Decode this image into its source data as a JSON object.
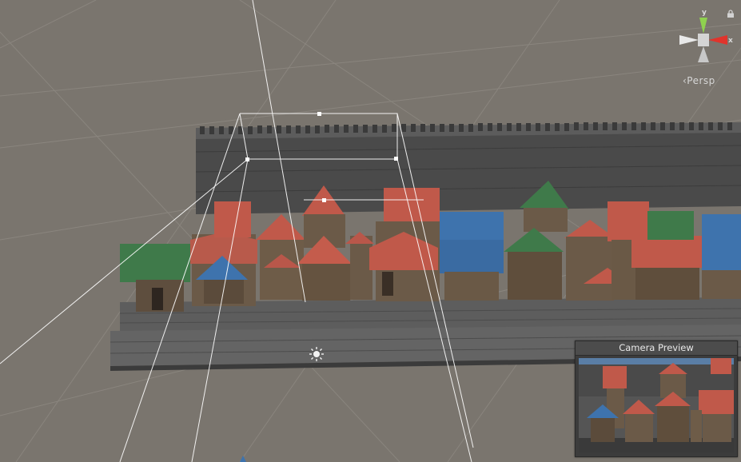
{
  "scene_view": {
    "projection_label": "‹Persp",
    "gizmo": {
      "axes": [
        "y",
        "x"
      ],
      "colors": {
        "x": "#e0342c",
        "y": "#8fd14f",
        "z": "#3a72d8",
        "neutral": "#d8d8d8"
      }
    },
    "lock_icon": "lock-icon"
  },
  "camera_preview": {
    "title": "Camera Preview"
  },
  "palette": {
    "ground": "#7a756e",
    "grid": "#8a857e",
    "wall": "#4a4a4a",
    "road": "#5b5b5b",
    "roof_red": "#c0594a",
    "roof_blue": "#3e73ad",
    "roof_green": "#3f7a4a",
    "timber": "#6b5a48",
    "frustum": "#ffffff"
  }
}
